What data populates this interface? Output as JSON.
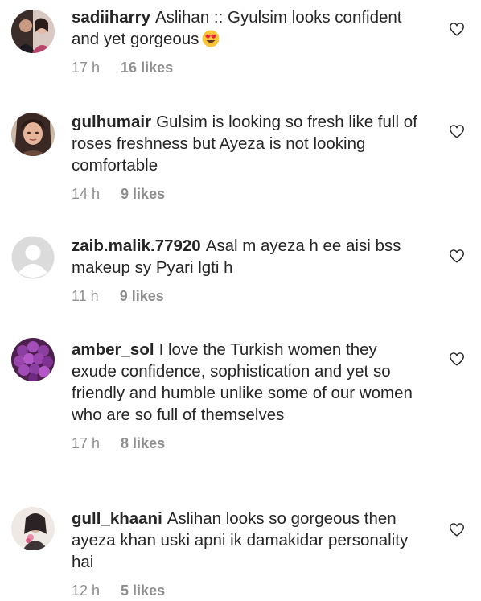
{
  "comments": [
    {
      "username": "sadiiharry",
      "text": "Aslihan :: Gyulsim looks confident and yet gorgeous",
      "emoji": "heart-eyes-emoji",
      "time": "17 h",
      "likes": "16 likes"
    },
    {
      "username": "gulhumair",
      "text": "Gulsim is looking so fresh like full of roses freshness but Ayeza is not looking comfortable",
      "time": "14 h",
      "likes": "9 likes"
    },
    {
      "username": "zaib.malik.77920",
      "text": "Asal m ayeza h ee aisi bss makeup sy Pyari lgti h",
      "time": "11 h",
      "likes": "9 likes"
    },
    {
      "username": "amber_sol",
      "text": "I love the Turkish women they exude confidence, sophistication and yet so friendly and humble unlike some of our women who are so full of themselves",
      "time": "17 h",
      "likes": "8 likes"
    },
    {
      "username": "gull_khaani",
      "text": "Aslihan looks so gorgeous then ayeza khan uski apni ik damakidar personality hai",
      "time": "12 h",
      "likes": "5 likes"
    }
  ],
  "icons": {
    "like": "heart-outline-icon",
    "emoji": "heart-eyes-emoji"
  },
  "colors": {
    "text": "#262626",
    "meta": "#8e8e8e"
  }
}
